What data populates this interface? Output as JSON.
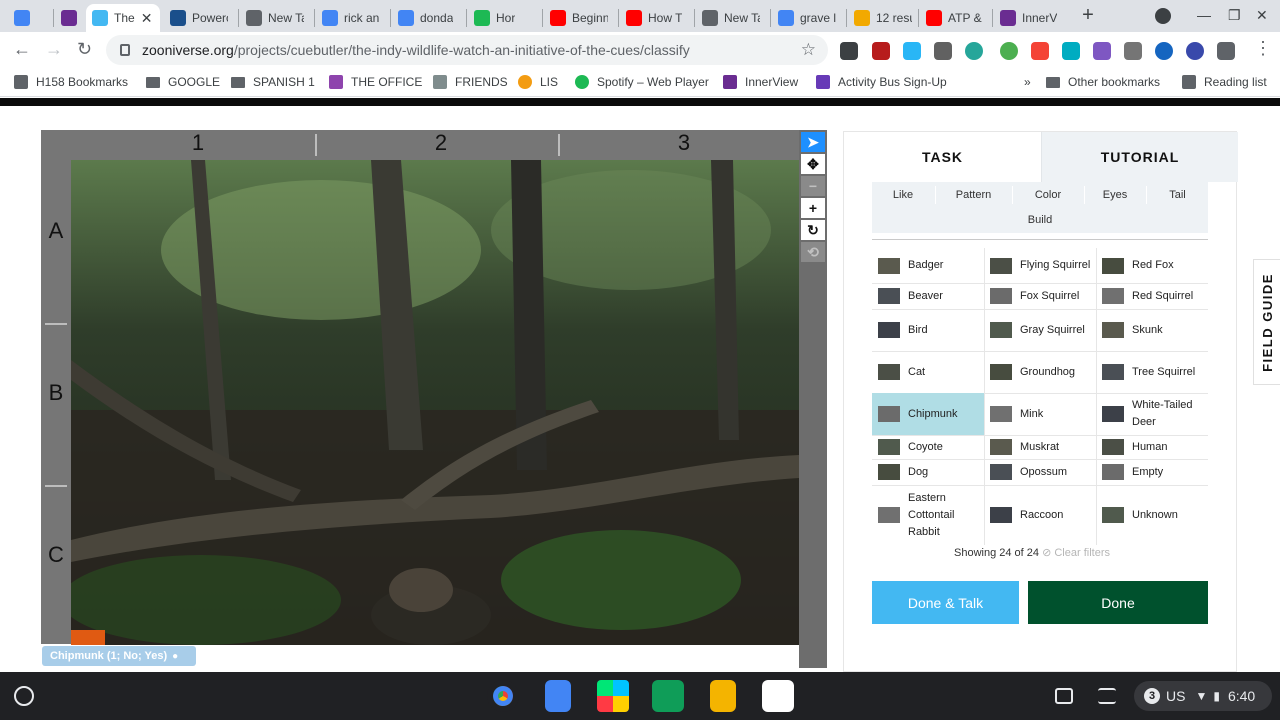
{
  "browser": {
    "tabs": [
      {
        "title": "",
        "icon": "google-docs-icon",
        "color": "#4285f4"
      },
      {
        "title": "",
        "icon": "innerview-icon",
        "color": "#6a2c91"
      },
      {
        "title": "The",
        "icon": "zooniverse-icon",
        "color": "#43b8f2",
        "active": true
      },
      {
        "title": "Powerc",
        "icon": "powerschool-icon",
        "color": "#1a4f8b"
      },
      {
        "title": "New Ta",
        "icon": "chrome-icon",
        "color": "#5f6368"
      },
      {
        "title": "rick an",
        "icon": "google-icon",
        "color": "#4285f4"
      },
      {
        "title": "donda",
        "icon": "google-icon",
        "color": "#4285f4"
      },
      {
        "title": "Hor",
        "icon": "spotify-icon",
        "color": "#1db954"
      },
      {
        "title": "Beginn",
        "icon": "youtube-icon",
        "color": "#ff0000"
      },
      {
        "title": "How T",
        "icon": "youtube-icon",
        "color": "#ff0000"
      },
      {
        "title": "New Ta",
        "icon": "chrome-icon",
        "color": "#5f6368"
      },
      {
        "title": "grave l",
        "icon": "google-icon",
        "color": "#4285f4"
      },
      {
        "title": "12 resu",
        "icon": "results-icon",
        "color": "#f2a900"
      },
      {
        "title": "ATP &",
        "icon": "youtube-icon",
        "color": "#ff0000"
      },
      {
        "title": "InnerV",
        "icon": "innerview-icon",
        "color": "#6a2c91"
      }
    ],
    "url_host": "zooniverse.org",
    "url_path": "/projects/cuebutler/the-indy-wildlife-watch-an-initiative-of-the-cues/classify"
  },
  "bookmarks": [
    {
      "label": "H158 Bookmarks",
      "icon": "bookmark-page-icon"
    },
    {
      "label": "GOOGLE",
      "icon": "folder-icon"
    },
    {
      "label": "SPANISH 1",
      "icon": "folder-icon"
    },
    {
      "label": "THE OFFICE",
      "icon": "office-icon"
    },
    {
      "label": "FRIENDS",
      "icon": "friends-icon"
    },
    {
      "label": "LIS",
      "icon": "lis-icon"
    },
    {
      "label": "Spotify – Web Player",
      "icon": "spotify-icon"
    },
    {
      "label": "InnerView",
      "icon": "innerview-icon"
    },
    {
      "label": "Activity Bus Sign-Up",
      "icon": "forms-icon"
    },
    {
      "label": "»",
      "icon": ""
    },
    {
      "label": "Other bookmarks",
      "icon": "folder-icon"
    },
    {
      "label": "Reading list",
      "icon": "reading-list-icon"
    }
  ],
  "subject_viewer": {
    "columns": [
      "1",
      "2",
      "3"
    ],
    "rows": [
      "A",
      "B",
      "C"
    ],
    "selection_tag": "Chipmunk (1; No; Yes)"
  },
  "task_panel": {
    "tabs": {
      "task": "TASK",
      "tutorial": "TUTORIAL"
    },
    "filters_row1": [
      "Like",
      "Pattern",
      "Color",
      "Eyes",
      "Tail"
    ],
    "filters_row2": [
      "Build"
    ],
    "choices": [
      [
        "Badger",
        "Flying Squirrel",
        "Red Fox"
      ],
      [
        "Beaver",
        "Fox Squirrel",
        "Red Squirrel"
      ],
      [
        "Bird",
        "Gray Squirrel",
        "Skunk"
      ],
      [
        "Cat",
        "Groundhog",
        "Tree Squirrel"
      ],
      [
        "Chipmunk",
        "Mink",
        "White-Tailed Deer"
      ],
      [
        "Coyote",
        "Muskrat",
        "Human"
      ],
      [
        "Dog",
        "Opossum",
        "Empty"
      ],
      [
        "Eastern Cottontail Rabbit",
        "Raccoon",
        "Unknown"
      ]
    ],
    "selected_choice": "Chipmunk",
    "showing_text": "Showing 24 of 24",
    "clear_filters": "Clear filters",
    "done_talk": "Done & Talk",
    "done": "Done",
    "field_guide": "FIELD GUIDE"
  },
  "shelf": {
    "notification_count": "3",
    "locale": "US",
    "time": "6:40"
  },
  "colors": {
    "selected_choice": "#b0dde5",
    "done_talk": "#43b8f2",
    "done": "#00512d",
    "tool_selected": "#1e90ff"
  }
}
